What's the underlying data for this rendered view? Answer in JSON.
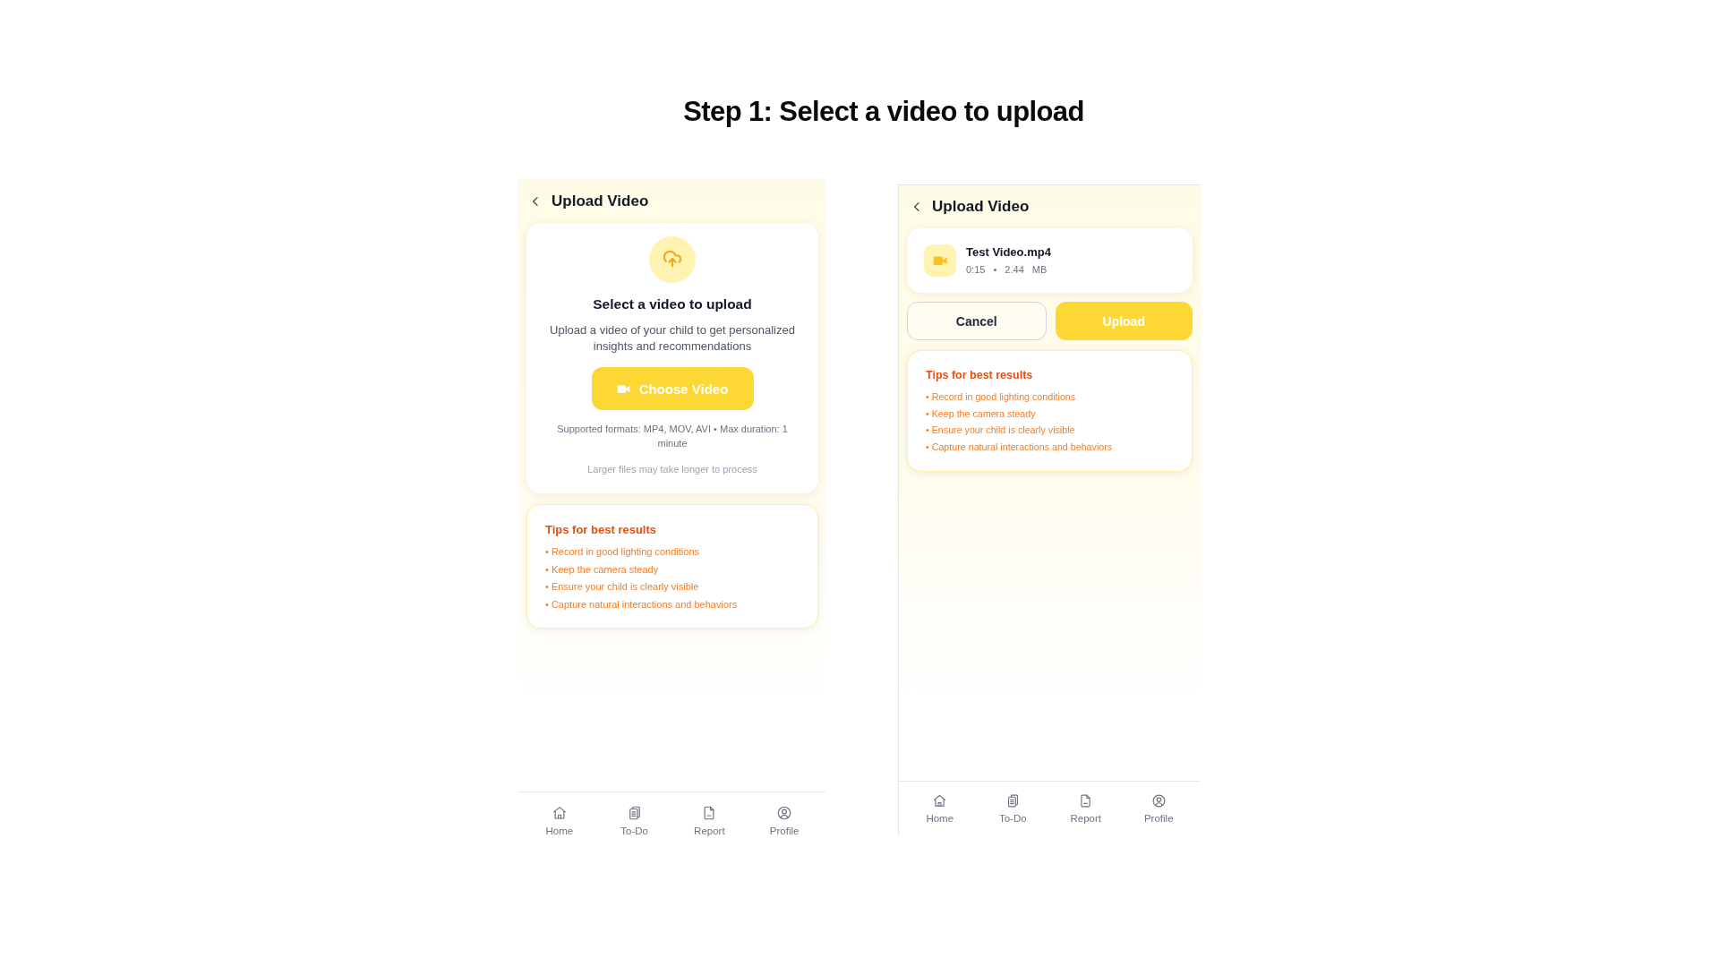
{
  "heading": "Step 1: Select a video to upload",
  "screens": [
    {
      "kind": "select",
      "header": {
        "title": "Upload Video"
      },
      "select_card": {
        "title": "Select a video to upload",
        "description": "Upload a video of your child to get personalized insights and recommendations",
        "button": "Choose Video",
        "formats_note": "Supported formats: MP4, MOV, AVI • Max duration: 1 minute",
        "size_note": "Larger files may take longer to process"
      },
      "tips": {
        "title": "Tips for best results",
        "items": [
          "• Record in good lighting conditions",
          "• Keep the camera steady",
          "• Ensure your child is clearly visible",
          "• Capture natural interactions and behaviors"
        ]
      },
      "nav": [
        {
          "label": "Home",
          "selected": false
        },
        {
          "label": "To-Do",
          "selected": false
        },
        {
          "label": "Report",
          "selected": false
        },
        {
          "label": "Profile",
          "selected": false
        }
      ]
    },
    {
      "kind": "selected",
      "header": {
        "title": "Upload Video"
      },
      "file_card": {
        "name": "Test Video.mp4",
        "meta": "0:15 • 2.44 MB"
      },
      "buttons": [
        {
          "label": "Cancel",
          "kind": "secondary"
        },
        {
          "label": "Upload",
          "kind": "primary"
        }
      ],
      "tips": {
        "title": "Tips for best results",
        "items": [
          "• Record in good lighting conditions",
          "• Keep the camera steady",
          "• Ensure your child is clearly visible",
          "• Capture natural interactions and behaviors"
        ]
      },
      "nav": [
        {
          "label": "Home",
          "selected": false
        },
        {
          "label": "To-Do",
          "selected": false
        },
        {
          "label": "Report",
          "selected": false
        },
        {
          "label": "Profile",
          "selected": false
        }
      ]
    }
  ]
}
